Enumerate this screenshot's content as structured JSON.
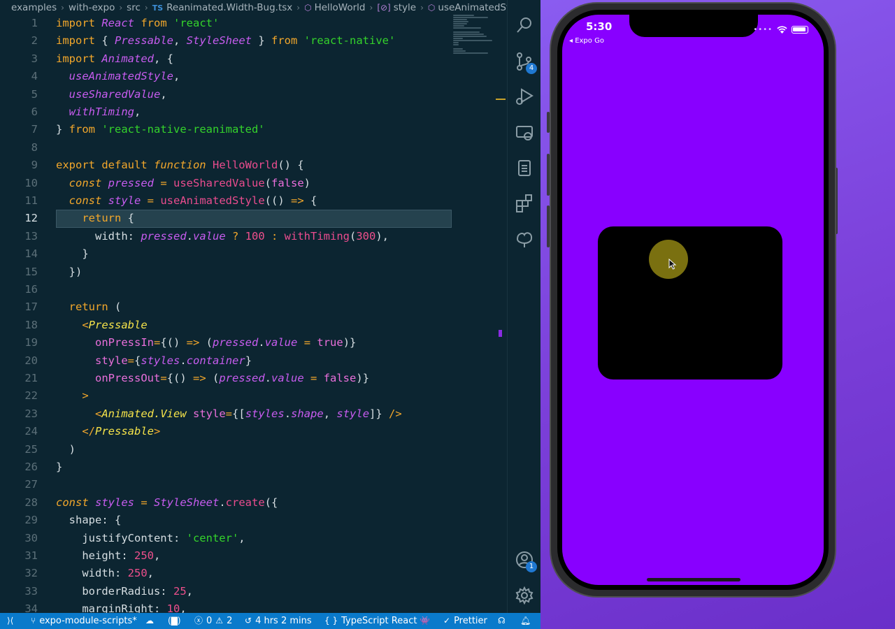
{
  "breadcrumb": {
    "items": [
      "examples",
      "with-expo",
      "src"
    ],
    "file_type": "TS",
    "file": "Reanimated.Width-Bug.tsx",
    "symbols": [
      "HelloWorld",
      "style",
      "useAnimatedStyle("
    ]
  },
  "editor": {
    "active_line": 12,
    "line_numbers": [
      "1",
      "2",
      "3",
      "4",
      "5",
      "6",
      "7",
      "8",
      "9",
      "10",
      "11",
      "12",
      "13",
      "14",
      "15",
      "16",
      "17",
      "18",
      "19",
      "20",
      "21",
      "22",
      "23",
      "24",
      "25",
      "26",
      "27",
      "28",
      "29",
      "30",
      "31",
      "32",
      "33",
      "34"
    ],
    "lines": [
      [
        [
          "kw",
          "import "
        ],
        [
          "cls",
          "React "
        ],
        [
          "kw",
          "from "
        ],
        [
          "str",
          "'react'"
        ]
      ],
      [
        [
          "kw",
          "import "
        ],
        [
          "pun",
          "{ "
        ],
        [
          "cls",
          "Pressable"
        ],
        [
          "pun",
          ", "
        ],
        [
          "cls",
          "StyleSheet "
        ],
        [
          "pun",
          "} "
        ],
        [
          "kw",
          "from "
        ],
        [
          "str",
          "'react-native'"
        ]
      ],
      [
        [
          "kw",
          "import "
        ],
        [
          "cls",
          "Animated"
        ],
        [
          "pun",
          ", {"
        ]
      ],
      [
        [
          "pun",
          "  "
        ],
        [
          "var",
          "useAnimatedStyle"
        ],
        [
          "pun",
          ","
        ]
      ],
      [
        [
          "pun",
          "  "
        ],
        [
          "var",
          "useSharedValue"
        ],
        [
          "pun",
          ","
        ]
      ],
      [
        [
          "pun",
          "  "
        ],
        [
          "var",
          "withTiming"
        ],
        [
          "pun",
          ","
        ]
      ],
      [
        [
          "pun",
          "} "
        ],
        [
          "kw",
          "from "
        ],
        [
          "str",
          "'react-native-reanimated'"
        ]
      ],
      [],
      [
        [
          "kw",
          "export default "
        ],
        [
          "ikw",
          "function "
        ],
        [
          "fn",
          "HelloWorld"
        ],
        [
          "pun",
          "() {"
        ]
      ],
      [
        [
          "pun",
          "  "
        ],
        [
          "ikw",
          "const "
        ],
        [
          "var",
          "pressed "
        ],
        [
          "op",
          "= "
        ],
        [
          "fn",
          "useSharedValue"
        ],
        [
          "pun",
          "("
        ],
        [
          "bool",
          "false"
        ],
        [
          "pun",
          ")"
        ]
      ],
      [
        [
          "pun",
          "  "
        ],
        [
          "ikw",
          "const "
        ],
        [
          "var",
          "style "
        ],
        [
          "op",
          "= "
        ],
        [
          "fn",
          "useAnimatedStyle"
        ],
        [
          "pun",
          "(() "
        ],
        [
          "op",
          "=> "
        ],
        [
          "pun",
          "{"
        ]
      ],
      [
        [
          "pun",
          "    "
        ],
        [
          "kw",
          "return "
        ],
        [
          "pun",
          "{"
        ]
      ],
      [
        [
          "pun",
          "      width: "
        ],
        [
          "var",
          "pressed"
        ],
        [
          "pun",
          "."
        ],
        [
          "prop",
          "value "
        ],
        [
          "op",
          "? "
        ],
        [
          "num",
          "100 "
        ],
        [
          "op",
          ": "
        ],
        [
          "fn",
          "withTiming"
        ],
        [
          "pun",
          "("
        ],
        [
          "num",
          "300"
        ],
        [
          "pun",
          "),"
        ]
      ],
      [
        [
          "pun",
          "    }"
        ]
      ],
      [
        [
          "pun",
          "  })"
        ]
      ],
      [],
      [
        [
          "pun",
          "  "
        ],
        [
          "kw",
          "return "
        ],
        [
          "pun",
          "("
        ]
      ],
      [
        [
          "pun",
          "    "
        ],
        [
          "op",
          "<"
        ],
        [
          "jsx",
          "Pressable"
        ]
      ],
      [
        [
          "pun",
          "      "
        ],
        [
          "attr",
          "onPressIn"
        ],
        [
          "op",
          "="
        ],
        [
          "pun",
          "{() "
        ],
        [
          "op",
          "=> "
        ],
        [
          "pun",
          "("
        ],
        [
          "var",
          "pressed"
        ],
        [
          "pun",
          "."
        ],
        [
          "prop",
          "value "
        ],
        [
          "op",
          "= "
        ],
        [
          "bool",
          "true"
        ],
        [
          "pun",
          ")}"
        ]
      ],
      [
        [
          "pun",
          "      "
        ],
        [
          "attr",
          "style"
        ],
        [
          "op",
          "="
        ],
        [
          "pun",
          "{"
        ],
        [
          "var",
          "styles"
        ],
        [
          "pun",
          "."
        ],
        [
          "prop",
          "container"
        ],
        [
          "pun",
          "}"
        ]
      ],
      [
        [
          "pun",
          "      "
        ],
        [
          "attr",
          "onPressOut"
        ],
        [
          "op",
          "="
        ],
        [
          "pun",
          "{() "
        ],
        [
          "op",
          "=> "
        ],
        [
          "pun",
          "("
        ],
        [
          "var",
          "pressed"
        ],
        [
          "pun",
          "."
        ],
        [
          "prop",
          "value "
        ],
        [
          "op",
          "= "
        ],
        [
          "bool",
          "false"
        ],
        [
          "pun",
          ")}"
        ]
      ],
      [
        [
          "pun",
          "    "
        ],
        [
          "op",
          ">"
        ]
      ],
      [
        [
          "pun",
          "      "
        ],
        [
          "op",
          "<"
        ],
        [
          "jsx",
          "Animated.View "
        ],
        [
          "attr",
          "style"
        ],
        [
          "op",
          "="
        ],
        [
          "pun",
          "{["
        ],
        [
          "var",
          "styles"
        ],
        [
          "pun",
          "."
        ],
        [
          "prop",
          "shape"
        ],
        [
          "pun",
          ", "
        ],
        [
          "var",
          "style"
        ],
        [
          "pun",
          "]} "
        ],
        [
          "op",
          "/>"
        ]
      ],
      [
        [
          "pun",
          "    "
        ],
        [
          "op",
          "</"
        ],
        [
          "jsx",
          "Pressable"
        ],
        [
          "op",
          ">"
        ]
      ],
      [
        [
          "pun",
          "  )"
        ]
      ],
      [
        [
          "pun",
          "}"
        ]
      ],
      [],
      [
        [
          "ikw",
          "const "
        ],
        [
          "var",
          "styles "
        ],
        [
          "op",
          "= "
        ],
        [
          "cls",
          "StyleSheet"
        ],
        [
          "pun",
          "."
        ],
        [
          "fn",
          "create"
        ],
        [
          "pun",
          "({"
        ]
      ],
      [
        [
          "pun",
          "  shape: {"
        ]
      ],
      [
        [
          "pun",
          "    justifyContent: "
        ],
        [
          "str",
          "'center'"
        ],
        [
          "pun",
          ","
        ]
      ],
      [
        [
          "pun",
          "    height: "
        ],
        [
          "num",
          "250"
        ],
        [
          "pun",
          ","
        ]
      ],
      [
        [
          "pun",
          "    width: "
        ],
        [
          "num",
          "250"
        ],
        [
          "pun",
          ","
        ]
      ],
      [
        [
          "pun",
          "    borderRadius: "
        ],
        [
          "num",
          "25"
        ],
        [
          "pun",
          ","
        ]
      ],
      [
        [
          "pun",
          "    marginRight: "
        ],
        [
          "num",
          "10"
        ],
        [
          "pun",
          ","
        ]
      ]
    ]
  },
  "activity_bar": {
    "items": [
      {
        "name": "search-icon"
      },
      {
        "name": "source-control-icon",
        "badge": "4"
      },
      {
        "name": "run-debug-icon"
      },
      {
        "name": "remote-explorer-icon"
      },
      {
        "name": "clipboard-icon"
      },
      {
        "name": "extensions-icon"
      },
      {
        "name": "docker-icon"
      }
    ],
    "bottom": [
      {
        "name": "account-icon",
        "badge": "1"
      },
      {
        "name": "gear-icon"
      }
    ]
  },
  "statusbar": {
    "branch": "expo-module-scripts*",
    "errors": "0",
    "warnings": "2",
    "time_tracked": "4 hrs 2 mins",
    "language": "TypeScript React",
    "formatter": "Prettier"
  },
  "phone": {
    "time": "5:30",
    "back_app": "◂ Expo Go",
    "screen_color": "#8800ff",
    "shape_color": "#000000",
    "touch_indicator_color": "#7a7010"
  }
}
